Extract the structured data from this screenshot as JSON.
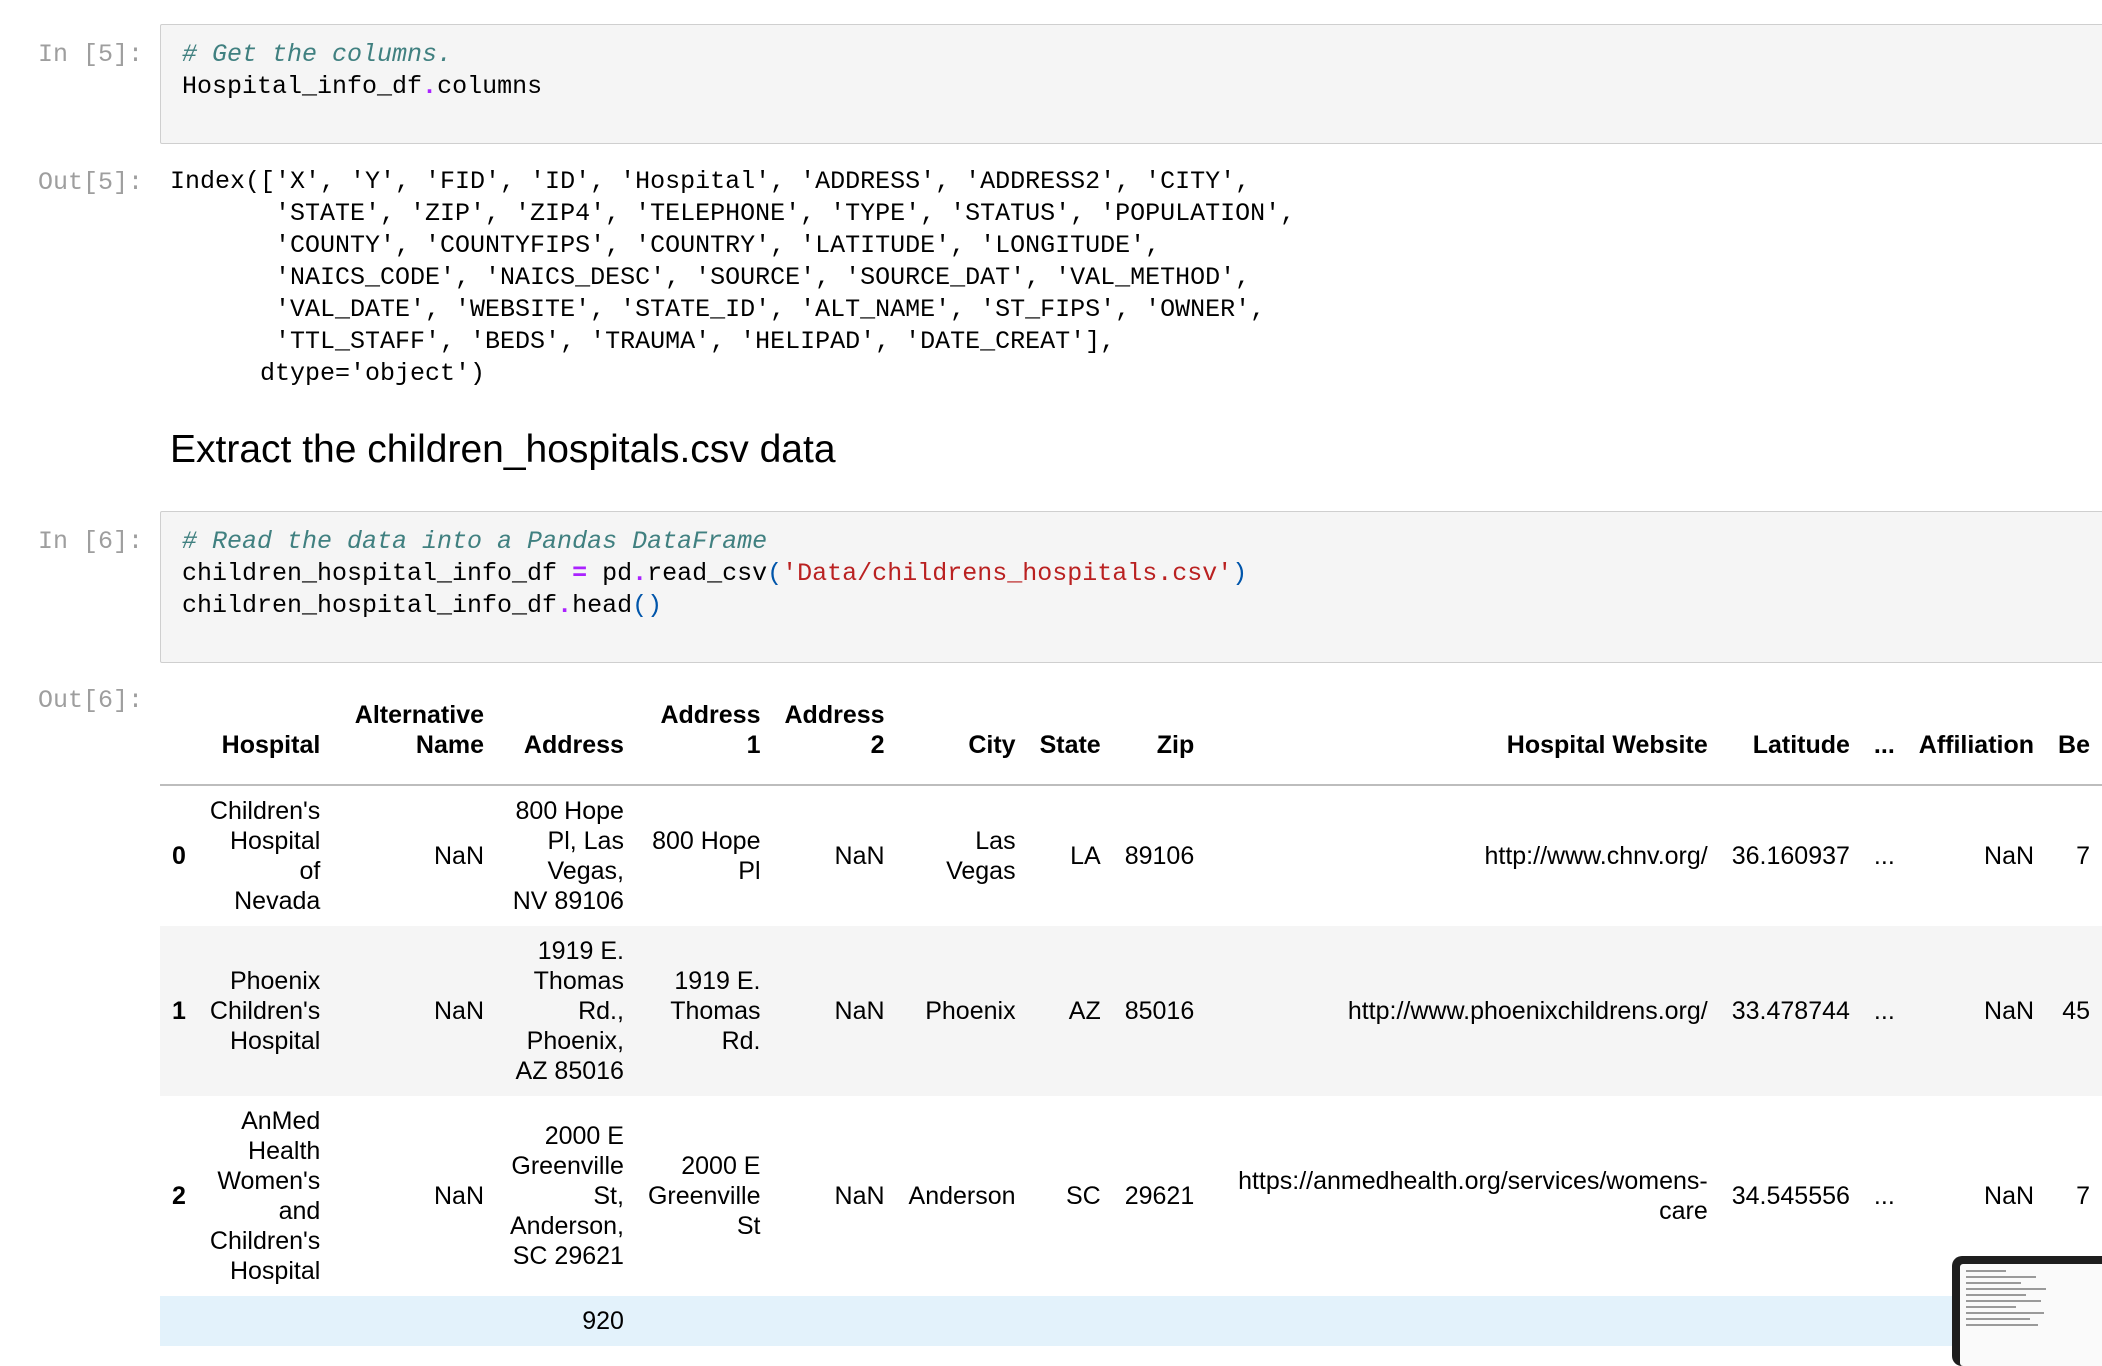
{
  "cells": {
    "in5": {
      "prompt": "In [5]:",
      "comment": "# Get the columns.",
      "code_var": "Hospital_info_df",
      "code_attr": "columns"
    },
    "out5": {
      "prompt": "Out[5]:",
      "lines": [
        "Index(['X', 'Y', 'FID', 'ID', 'Hospital', 'ADDRESS', 'ADDRESS2', 'CITY',",
        "       'STATE', 'ZIP', 'ZIP4', 'TELEPHONE', 'TYPE', 'STATUS', 'POPULATION',",
        "       'COUNTY', 'COUNTYFIPS', 'COUNTRY', 'LATITUDE', 'LONGITUDE',",
        "       'NAICS_CODE', 'NAICS_DESC', 'SOURCE', 'SOURCE_DAT', 'VAL_METHOD',",
        "       'VAL_DATE', 'WEBSITE', 'STATE_ID', 'ALT_NAME', 'ST_FIPS', 'OWNER',",
        "       'TTL_STAFF', 'BEDS', 'TRAUMA', 'HELIPAD', 'DATE_CREAT'],",
        "      dtype='object')"
      ]
    },
    "heading": "Extract the children_hospitals.csv data",
    "in6": {
      "prompt": "In [6]:",
      "comment": "# Read the data into a Pandas DataFrame",
      "line2_var": "children_hospital_info_df ",
      "line2_op": "=",
      "line2_mid": " pd",
      "line2_func": "read_csv",
      "line2_str": "'Data/childrens_hospitals.csv'",
      "line3_var": "children_hospital_info_df",
      "line3_func": "head"
    },
    "out6": {
      "prompt": "Out[6]:",
      "columns": [
        "",
        "Hospital",
        "Alternative Name",
        "Address",
        "Address 1",
        "Address 2",
        "City",
        "State",
        "Zip",
        "Hospital Website",
        "Latitude",
        "...",
        "Affiliation",
        "Be"
      ],
      "rows": [
        [
          "0",
          "Children's Hospital of Nevada",
          "NaN",
          "800 Hope Pl, Las Vegas, NV 89106",
          "800 Hope Pl",
          "NaN",
          "Las Vegas",
          "LA",
          "89106",
          "http://www.chnv.org/",
          "36.160937",
          "...",
          "NaN",
          "7"
        ],
        [
          "1",
          "Phoenix Children's Hospital",
          "NaN",
          "1919 E. Thomas Rd., Phoenix, AZ 85016",
          "1919 E. Thomas Rd.",
          "NaN",
          "Phoenix",
          "AZ",
          "85016",
          "http://www.phoenixchildrens.org/",
          "33.478744",
          "...",
          "NaN",
          "45"
        ],
        [
          "2",
          "AnMed Health Women's and Children's Hospital",
          "NaN",
          "2000 E Greenville St, Anderson, SC 29621",
          "2000 E Greenville St",
          "NaN",
          "Anderson",
          "SC",
          "29621",
          "https://anmedhealth.org/services/womens-care",
          "34.545556",
          "...",
          "NaN",
          "7"
        ],
        [
          "",
          "",
          "",
          "920",
          "",
          "",
          "",
          "",
          "",
          "",
          "",
          "",
          "",
          ""
        ]
      ]
    }
  }
}
